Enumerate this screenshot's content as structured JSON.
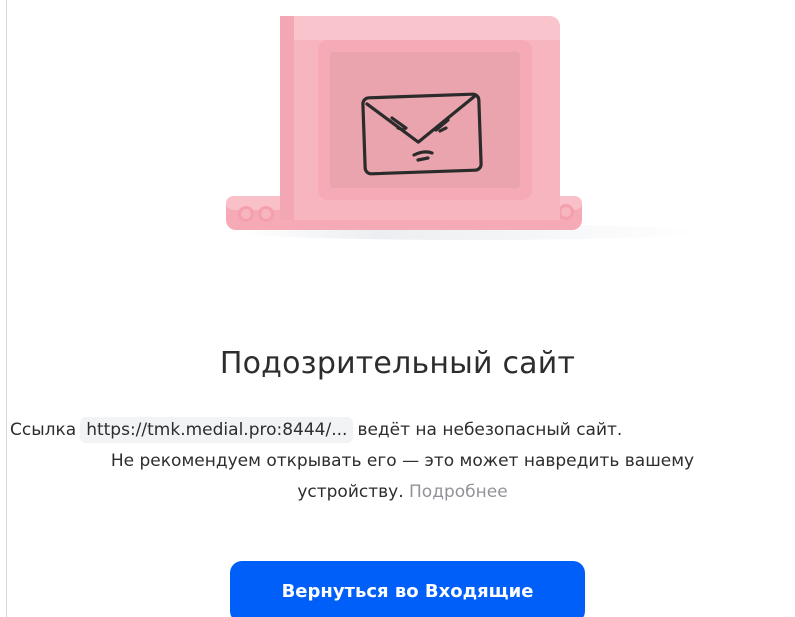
{
  "illustration": {
    "icon": "angry-envelope-icon",
    "device_color": "#f7b5bf"
  },
  "title": "Подозрительный сайт",
  "message": {
    "before_link": "Ссылка",
    "url": "https://tmk.medial.pro:8444/...",
    "after_link": "ведёт на небезопасный сайт.",
    "line2": "Не рекомендуем открывать его — это может навредить вашему",
    "line3_text": "устройству.",
    "more_link": "Подробнее"
  },
  "button": {
    "label": "Вернуться во Входящие",
    "color": "#005ff9"
  }
}
